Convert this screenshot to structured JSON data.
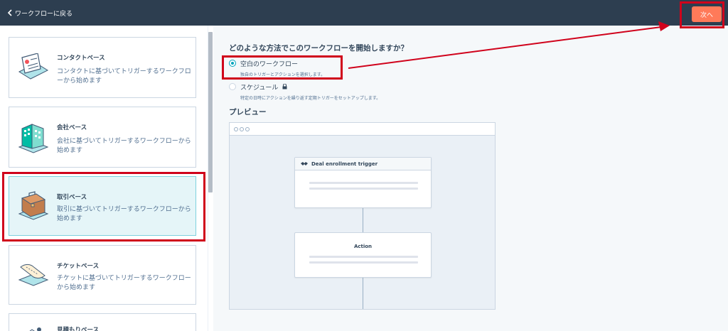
{
  "topbar": {
    "back_label": "ワークフローに戻る",
    "next_label": "次へ"
  },
  "sidebar": {
    "cards": [
      {
        "title": "コンタクトベース",
        "desc": "コンタクトに基づいてトリガーするワークフローから始めます"
      },
      {
        "title": "会社ベース",
        "desc": "会社に基づいてトリガーするワークフローから始めます"
      },
      {
        "title": "取引ベース",
        "desc": "取引に基づいてトリガーするワークフローから始めます"
      },
      {
        "title": "チケットベース",
        "desc": "チケットに基づいてトリガーするワークフローから始めます"
      },
      {
        "title": "見積もりベース"
      }
    ],
    "selected_index": 2
  },
  "main": {
    "question": "どのような方法でこのワークフローを開始しますか？",
    "options": [
      {
        "label": "空白のワークフロー",
        "sub": "独自のトリガーとアクションを選択します。",
        "selected": true
      },
      {
        "label": "スケジュール",
        "sub": "特定の日時にアクションを繰り返す定期トリガーをセットアップします。",
        "selected": false,
        "locked": true
      }
    ],
    "preview_title": "プレビュー",
    "preview": {
      "trigger_label": "Deal enrollment trigger",
      "action_label": "Action"
    }
  },
  "colors": {
    "topbar": "#2d3e50",
    "accent_orange": "#ff7a59",
    "selected_card": "#e5f5f8",
    "annotation_red": "#d0021b"
  },
  "icons": [
    "chevron-left-icon",
    "lock-icon",
    "handshake-icon",
    "contact-card-icon",
    "building-icon",
    "briefcase-icon",
    "ticket-icon"
  ]
}
